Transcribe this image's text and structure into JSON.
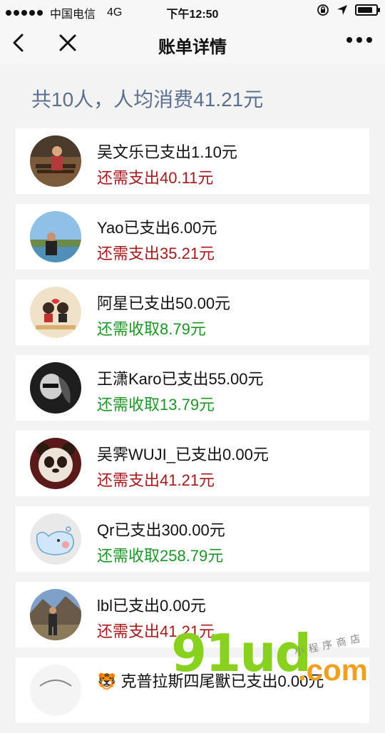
{
  "status_bar": {
    "carrier": "中国电信",
    "network": "4G",
    "time": "下午12:50"
  },
  "nav": {
    "title": "账单详情"
  },
  "summary": "共10人，人均消费41.21元",
  "members": [
    {
      "paid": "吴文乐已支出1.10元",
      "status": "还需支出40.11元",
      "type": "pay"
    },
    {
      "paid": "Yao已支出6.00元",
      "status": "还需支出35.21元",
      "type": "pay"
    },
    {
      "paid": "阿星已支出50.00元",
      "status": "还需收取8.79元",
      "type": "get"
    },
    {
      "paid": "王潇Karo已支出55.00元",
      "status": "还需收取13.79元",
      "type": "get"
    },
    {
      "paid": "吴霁WUJI_已支出0.00元",
      "status": "还需支出41.21元",
      "type": "pay"
    },
    {
      "paid": "Qr已支出300.00元",
      "status": "还需收取258.79元",
      "type": "get"
    },
    {
      "paid": "lbl已支出0.00元",
      "status": "还需支出41.21元",
      "type": "pay"
    },
    {
      "paid": "🐯 克普拉斯四尾獸已支出0.00元",
      "status": "",
      "type": "pay"
    }
  ],
  "colors": {
    "need_pay": "#a5191a",
    "need_get": "#1f9528",
    "summary": "#5b6f8f"
  },
  "watermark": {
    "big": "91ud",
    "com": ".com",
    "small": "小程序商店"
  }
}
